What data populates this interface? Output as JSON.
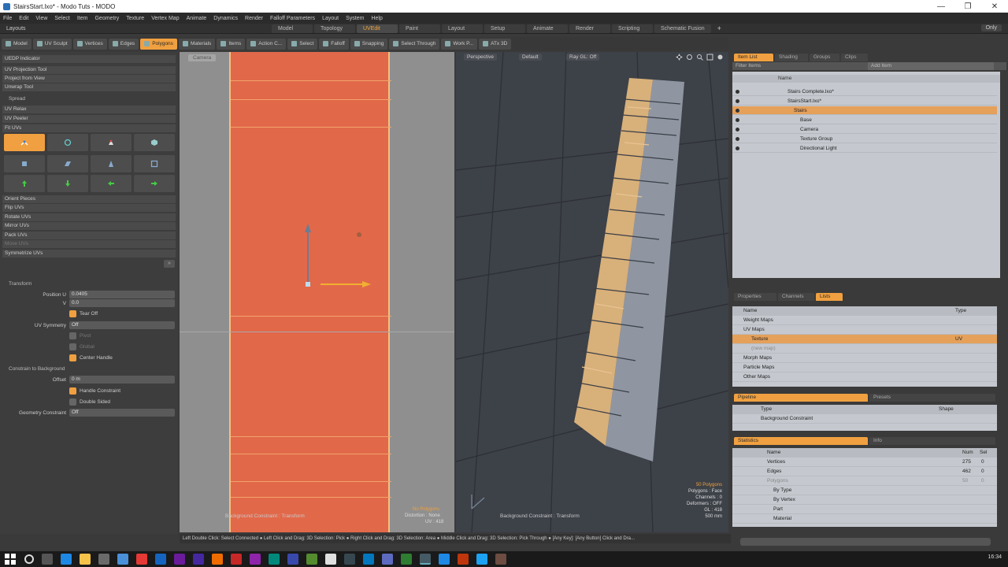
{
  "window": {
    "title": "StairsStart.lxo* - Modo Tuts - MODO",
    "controls": [
      "—",
      "❐",
      "✕"
    ]
  },
  "menu": [
    "File",
    "Edit",
    "View",
    "Select",
    "Item",
    "Geometry",
    "Texture",
    "Vertex Map",
    "Animate",
    "Dynamics",
    "Render",
    "Falloff Parameters",
    "Layout",
    "System",
    "Help"
  ],
  "layout_bar": {
    "label": "Layouts",
    "tabs": [
      {
        "label": "Model",
        "active": false
      },
      {
        "label": "Topology",
        "active": false
      },
      {
        "label": "UVEdit",
        "active": true
      },
      {
        "label": "Paint",
        "active": false
      },
      {
        "label": "Layout",
        "active": false
      },
      {
        "label": "Setup",
        "active": false
      },
      {
        "label": "Animate",
        "active": false
      },
      {
        "label": "Render",
        "active": false
      },
      {
        "label": "Scripting",
        "active": false
      },
      {
        "label": "Schematic Fusion",
        "active": false
      }
    ],
    "plus": "+",
    "only": "Only"
  },
  "mode_toolbar": [
    {
      "label": "Model",
      "active": false
    },
    {
      "label": "UV Sculpt",
      "active": false
    },
    {
      "label": "Vertices",
      "active": false
    },
    {
      "label": "Edges",
      "active": false
    },
    {
      "label": "Polygons",
      "active": true
    },
    {
      "label": "Materials",
      "active": false
    },
    {
      "label": "Items",
      "active": false
    },
    {
      "label": "Action C...",
      "active": false
    },
    {
      "label": "Select",
      "active": false
    },
    {
      "label": "Falloff",
      "active": false
    },
    {
      "label": "Snapping",
      "active": false
    },
    {
      "label": "Select Through",
      "active": false
    },
    {
      "label": "Work P...",
      "active": false
    },
    {
      "label": "ATx 3D",
      "active": false
    }
  ],
  "left_panel": {
    "top_items": [
      "UEDP Indicator",
      "UV Projection Tool",
      "Project from View",
      "Unwrap Tool"
    ],
    "spread_header": "Spread",
    "spread_items": [
      "UV Relax",
      "UV Peeler",
      "Fit UVs"
    ],
    "lower_items": [
      {
        "label": "Orient Pieces",
        "dim": false
      },
      {
        "label": "Flip UVs",
        "dim": false
      },
      {
        "label": "Rotate UVs",
        "dim": false
      },
      {
        "label": "Mirror UVs",
        "dim": false
      },
      {
        "label": "Pack UVs",
        "dim": false
      },
      {
        "label": "Move UVs",
        "dim": true
      },
      {
        "label": "Symmetrize UVs",
        "dim": false
      }
    ],
    "transform_header": "Transform",
    "position_u_label": "Position U",
    "position_u": "0.0405",
    "position_v_label": "V",
    "position_v": "0.0",
    "tear_off": "Tear Off",
    "uv_symmetry_label": "UV Symmetry",
    "uv_symmetry": "Off",
    "pivot": "Pivot",
    "global": "Global",
    "center_handle": "Center Handle",
    "constrain_header": "Constrain to Background",
    "offset_label": "Offset",
    "offset": "0 m",
    "handle_constraint": "Handle Constraint",
    "double_sided": "Double Sided",
    "geometry_constraint_label": "Geometry Constraint",
    "geometry_constraint": "Off"
  },
  "uv_view": {
    "header": "Camera",
    "footer_left": "Background Constraint : Transform",
    "footer_right": [
      "No Polygons",
      "Distortion : None",
      "UV : 418"
    ]
  },
  "view3d": {
    "header": [
      "Perspective",
      "Default",
      "Ray GL: Off"
    ],
    "footer_left": "Background Constraint : Transform",
    "info": [
      "50 Polygons",
      "Polygons : Face",
      "Channels : 0",
      "Deformers : OFF",
      "GL : 418",
      "500 mm"
    ]
  },
  "items_panel": {
    "tabs": [
      {
        "label": "Item List",
        "active": true
      },
      {
        "label": "Shading",
        "active": false
      },
      {
        "label": "Groups",
        "active": false
      },
      {
        "label": "Clips",
        "active": false
      }
    ],
    "filter": "Filter Items",
    "add_item": "Add Item",
    "column_name": "Name",
    "rows": [
      {
        "name": "Stairs Complete.lxo*",
        "indent": 0,
        "selected": false
      },
      {
        "name": "StairsStart.lxo*",
        "indent": 0,
        "selected": false
      },
      {
        "name": "Stairs",
        "indent": 1,
        "selected": true
      },
      {
        "name": "Base",
        "indent": 2,
        "selected": false
      },
      {
        "name": "Camera",
        "indent": 2,
        "selected": false
      },
      {
        "name": "Texture Group",
        "indent": 2,
        "selected": false
      },
      {
        "name": "Directional Light",
        "indent": 2,
        "selected": false
      }
    ]
  },
  "props_panel": {
    "tabs": [
      {
        "label": "Properties",
        "active": false
      },
      {
        "label": "Channels",
        "active": false
      },
      {
        "label": "Lists",
        "active": true
      }
    ],
    "col_name": "Name",
    "col_type": "Type",
    "rows": [
      {
        "name": "Weight Maps",
        "type": ""
      },
      {
        "name": "UV Maps",
        "type": ""
      },
      {
        "name": "Texture",
        "type": "UV"
      },
      {
        "name": "(new map)",
        "type": ""
      },
      {
        "name": "Morph Maps",
        "type": ""
      },
      {
        "name": "Particle Maps",
        "type": ""
      },
      {
        "name": "Other Maps",
        "type": ""
      }
    ]
  },
  "pipeline_panel": {
    "tabs": [
      {
        "label": "Pipeline",
        "active": true
      },
      {
        "label": "Presets",
        "active": false
      }
    ],
    "col_type": "Type",
    "col_shape": "Shape",
    "row": "Background Constraint"
  },
  "stats_panel": {
    "tabs": [
      {
        "label": "Statistics",
        "active": true
      },
      {
        "label": "Info",
        "active": false
      }
    ],
    "col_name": "Name",
    "col_num": "Num",
    "col_sel": "Sel",
    "rows": [
      {
        "name": "Vertices",
        "num": "275",
        "sel": "0"
      },
      {
        "name": "Edges",
        "num": "462",
        "sel": "0"
      },
      {
        "name": "Polygons",
        "num": "50",
        "sel": "0"
      },
      {
        "name": "By Type",
        "num": "",
        "sel": ""
      },
      {
        "name": "By Vertex",
        "num": "",
        "sel": ""
      },
      {
        "name": "Part",
        "num": "",
        "sel": ""
      },
      {
        "name": "Material",
        "num": "",
        "sel": ""
      }
    ]
  },
  "status_bar": "Left Double Click: Select Connected ● Left Click and Drag: 3D Selection: Pick ● Right Click and Drag: 3D Selection: Area ● Middle Click and Drag: 3D Selection: Pick Through ● [Any Key]: [Any Button] Click and Dra...",
  "taskbar": {
    "clock": "16:34"
  },
  "colors": {
    "accent": "#f0a040",
    "uv_orange": "#e2684a",
    "viewport": "#3d4148"
  }
}
